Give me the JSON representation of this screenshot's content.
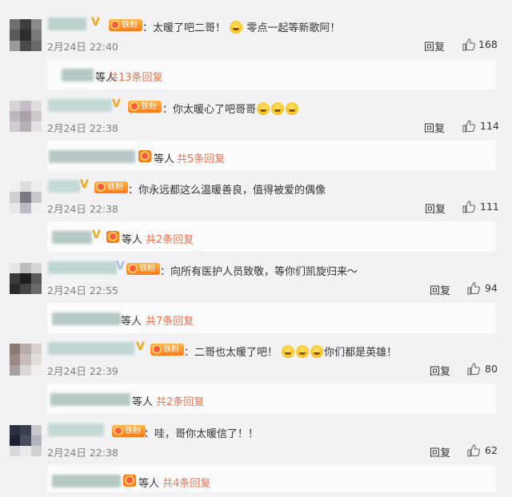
{
  "icons": {
    "like": "thumbs-up-icon",
    "emoji": "crying-face-icon",
    "verified": "v-badge-icon",
    "fan_badge": "fan-badge-icon"
  },
  "colors": {
    "accent": "#eb7350",
    "badge": "#f3a81c",
    "time": "#808080"
  },
  "comments": [
    {
      "badge": "铁粉",
      "text": "太暖了吧二哥！",
      "text2": "零点一起等新歌阿！",
      "time": "2月24日 22:40",
      "reply": "回复",
      "likes": "168",
      "sub_suffix": "等人",
      "sub_count": "共13条回复"
    },
    {
      "badge": "铁粉",
      "text": "你太暖心了吧哥哥",
      "time": "2月24日 22:38",
      "reply": "回复",
      "likes": "114",
      "sub_suffix": "等人",
      "sub_count": "共5条回复"
    },
    {
      "badge": "铁粉",
      "text": "你永远都这么温暖善良，值得被爱的偶像",
      "time": "2月24日 22:38",
      "reply": "回复",
      "likes": "111",
      "sub_suffix": "等人",
      "sub_count": "共2条回复"
    },
    {
      "badge": "铁粉",
      "text": "向所有医护人员致敬，等你们凯旋归来～",
      "time": "2月24日 22:55",
      "reply": "回复",
      "likes": "94",
      "sub_suffix": "等人",
      "sub_count": "共7条回复"
    },
    {
      "badge": "铁粉",
      "text": "二哥也太暖了吧！",
      "text2": "你们都是英雄！",
      "time": "2月24日 22:39",
      "reply": "回复",
      "likes": "80",
      "sub_suffix": "等人",
      "sub_count": "共2条回复"
    },
    {
      "badge": "铁粉",
      "text": "哇，哥你太暖信了！！",
      "time": "2月24日 22:38",
      "reply": "回复",
      "likes": "62",
      "sub_suffix": "等人",
      "sub_count": "共4条回复"
    }
  ]
}
